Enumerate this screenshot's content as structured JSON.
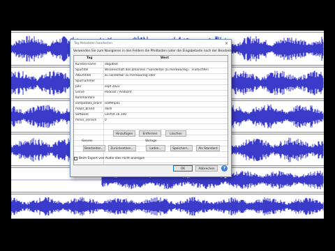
{
  "dialog": {
    "title": "Tag Metadaten bearbeiten",
    "close_glyph": "×",
    "instructions": "Verwenden Sie zum Navigieren in den Feldern die Pfeiltasten (oder die Eingabetaste nach der Bearbeitung)",
    "table": {
      "headers": [
        "Tag",
        "Wert"
      ],
      "rows": [
        [
          "Künstlername",
          "dagobeit"
        ],
        [
          "Spurtitel",
          "Wissenschaft des Johannes /\"Sonderbar zu merkwürdig í¨ Frühlichten"
        ],
        [
          "Albumtitel",
          "zu sonderbar zu merkwürdig oder"
        ],
        [
          "Spurnummer",
          ""
        ],
        [
          "Jahr",
          "sept 2022"
        ],
        [
          "Genre",
          "Podcast / Andacht"
        ],
        [
          "Kommentare",
          ""
        ],
        [
          "compatible_brands",
          "isoMmp41"
        ],
        [
          "major_brand",
          "dash"
        ],
        [
          "Software",
          "Lavf59.16.100"
        ],
        [
          "minor_version",
          "0"
        ],
        [
          "",
          ""
        ],
        [
          "",
          ""
        ],
        [
          "",
          ""
        ],
        [
          "",
          ""
        ],
        [
          "",
          ""
        ],
        [
          "",
          ""
        ],
        [
          "",
          ""
        ]
      ]
    },
    "buttons": {
      "add": "Hinzufügen",
      "remove": "Entfernen",
      "clear": "Löschen",
      "edit": "Bearbeiten...",
      "reset": "Zurücksetzen...",
      "load": "Laden...",
      "save": "Speichern...",
      "as_default": "Als Standard",
      "ok": "OK",
      "cancel": "Abbrechen"
    },
    "genres_label": "Genres",
    "template_label": "Vorlage",
    "checkbox_label": "Beim Export von Audio dies nicht anzeigen",
    "checkbox_checked": false,
    "help_glyph": "?"
  },
  "colors": {
    "waveform": "#3a3acb",
    "waveform_light": "#8f8fe6",
    "track_bg": "#ffffff",
    "editor_bg": "#e4e4e6"
  }
}
